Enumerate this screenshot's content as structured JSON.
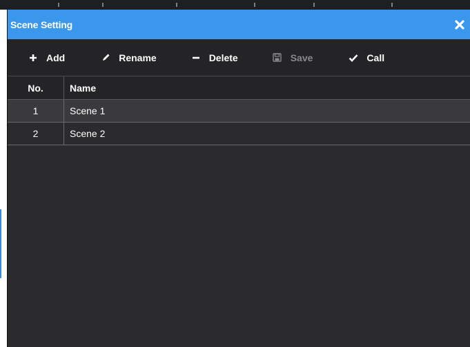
{
  "dialog": {
    "title": "Scene Setting",
    "close_icon": "close-icon",
    "accent_color": "#3b97ec",
    "background_color": "#2b2b2d"
  },
  "toolbar": {
    "add_label": "Add",
    "rename_label": "Rename",
    "delete_label": "Delete",
    "save_label": "Save",
    "call_label": "Call",
    "icons": [
      "plus-icon",
      "pencil-icon",
      "minus-icon",
      "save-icon",
      "checkmark-icon"
    ]
  },
  "table": {
    "headers": {
      "no": "No.",
      "name": "Name"
    },
    "rows": [
      {
        "no": "1",
        "name": "Scene 1",
        "selected": true
      },
      {
        "no": "2",
        "name": "Scene 2",
        "selected": false
      }
    ]
  }
}
